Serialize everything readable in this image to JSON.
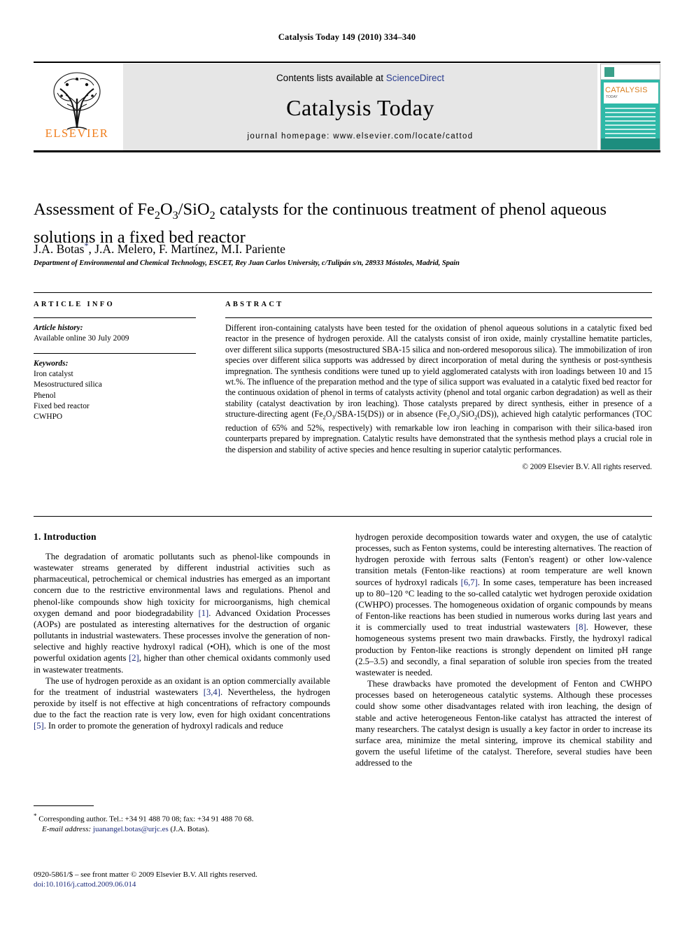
{
  "running_head": "Catalysis Today 149 (2010) 334–340",
  "masthead": {
    "contents_prefix": "Contents lists available at ",
    "sciencedirect": "ScienceDirect",
    "journal_name": "Catalysis Today",
    "homepage": "journal homepage: www.elsevier.com/locate/cattod",
    "publisher": "ELSEVIER",
    "cover": {
      "title": "CATALYSIS",
      "subtitle": "TODAY"
    }
  },
  "article": {
    "title_line1_a": "Assessment of Fe",
    "title_sub1": "2",
    "title_line1_b": "O",
    "title_sub2": "3",
    "title_line1_c": "/SiO",
    "title_sub3": "2",
    "title_line1_d": " catalysts for the continuous treatment of phenol",
    "title_line2": "aqueous solutions in a fixed bed reactor",
    "authors": "J.A. Botas",
    "author_mark": "*",
    "authors_rest": ", J.A. Melero, F. Martínez, M.I. Pariente",
    "affiliation": "Department of Environmental and Chemical Technology, ESCET, Rey Juan Carlos University, c/Tulipán s/n, 28933 Móstoles, Madrid, Spain"
  },
  "info": {
    "heading": "ARTICLE INFO",
    "history_label": "Article history:",
    "history_value": "Available online 30 July 2009",
    "keywords_label": "Keywords:",
    "keywords": [
      "Iron catalyst",
      "Mesostructured silica",
      "Phenol",
      "Fixed bed reactor",
      "CWHPO"
    ]
  },
  "abstract": {
    "heading": "ABSTRACT",
    "p1_a": "Different iron-containing catalysts have been tested for the oxidation of phenol aqueous solutions in a catalytic fixed bed reactor in the presence of hydrogen peroxide. All the catalysts consist of iron oxide, mainly crystalline hematite particles, over different silica supports (mesostructured SBA-15 silica and non-ordered mesoporous silica). The immobilization of iron species over different silica supports was addressed by direct incorporation of metal during the synthesis or post-synthesis impregnation. The synthesis conditions were tuned up to yield agglomerated catalysts with iron loadings between 10 and 15 wt.%. The influence of the preparation method and the type of silica support was evaluated in a catalytic fixed bed reactor for the continuous oxidation of phenol in terms of catalysts activity (phenol and total organic carbon degradation) as well as their stability (catalyst deactivation by iron leaching). Those catalysts prepared by direct synthesis, either in presence of a structure-directing agent (Fe",
    "sub_a": "2",
    "p1_b": "O",
    "sub_b": "3",
    "p1_c": "/SBA-15(DS)) or in absence (Fe",
    "sub_c": "2",
    "p1_d": "O",
    "sub_d": "3",
    "p1_e": "/SiO",
    "sub_e": "2",
    "p1_f": "(DS)), achieved high catalytic performances (TOC reduction of 65% and 52%, respectively) with remarkable low iron leaching in comparison with their silica-based iron counterparts prepared by impregnation. Catalytic results have demonstrated that the synthesis method plays a crucial role in the dispersion and stability of active species and hence resulting in superior catalytic performances.",
    "copyright": "© 2009 Elsevier B.V. All rights reserved."
  },
  "body": {
    "section_number_title": "1. Introduction",
    "left_p1_a": "The degradation of aromatic pollutants such as phenol-like compounds in wastewater streams generated by different industrial activities such as pharmaceutical, petrochemical or chemical industries has emerged as an important concern due to the restrictive environmental laws and regulations. Phenol and phenol-like compounds show high toxicity for microorganisms, high chemical oxygen demand and poor biodegradability ",
    "ref1": "[1]",
    "left_p1_b": ". Advanced Oxidation Processes (AOPs) are postulated as interesting alternatives for the destruction of organic pollutants in industrial wastewaters. These processes involve the generation of non-selective and highly reactive hydroxyl radical (•OH), which is one of the most powerful oxidation agents ",
    "ref2": "[2]",
    "left_p1_c": ", higher than other chemical oxidants commonly used in wastewater treatments.",
    "left_p2_a": "The use of hydrogen peroxide as an oxidant is an option commercially available for the treatment of industrial wastewaters ",
    "ref34": "[3,4]",
    "left_p2_b": ". Nevertheless, the hydrogen peroxide by itself is not effective at high concentrations of refractory compounds due to the fact the reaction rate is very low, even for high oxidant concentrations ",
    "ref5": "[5]",
    "left_p2_c": ". In order to promote the generation of hydroxyl radicals and reduce",
    "right_p1_a": "hydrogen peroxide decomposition towards water and oxygen, the use of catalytic processes, such as Fenton systems, could be interesting alternatives. The reaction of hydrogen peroxide with ferrous salts (Fenton's reagent) or other low-valence transition metals (Fenton-like reactions) at room temperature are well known sources of hydroxyl radicals ",
    "ref67": "[6,7]",
    "right_p1_b": ". In some cases, temperature has been increased up to 80–120 °C leading to the so-called catalytic wet hydrogen peroxide oxidation (CWHPO) processes. The homogeneous oxidation of organic compounds by means of Fenton-like reactions has been studied in numerous works during last years and it is commercially used to treat industrial wastewaters ",
    "ref8": "[8]",
    "right_p1_c": ". However, these homogeneous systems present two main drawbacks. Firstly, the hydroxyl radical production by Fenton-like reactions is strongly dependent on limited pH range (2.5–3.5) and secondly, a final separation of soluble iron species from the treated wastewater is needed.",
    "right_p2": "These drawbacks have promoted the development of Fenton and CWHPO processes based on heterogeneous catalytic systems. Although these processes could show some other disadvantages related with iron leaching, the design of stable and active heterogeneous Fenton-like catalyst has attracted the interest of many researchers. The catalyst design is usually a key factor in order to increase its surface area, minimize the metal sintering, improve its chemical stability and govern the useful lifetime of the catalyst. Therefore, several studies have been addressed to the"
  },
  "footnote": {
    "star": "*",
    "corresponding": " Corresponding author. Tel.: +34 91 488 70 08; fax: +34 91 488 70 68.",
    "email_label": "E-mail address:",
    "email": "juanangel.botas@urjc.es",
    "email_owner": "(J.A. Botas)."
  },
  "footer": {
    "issn_line": "0920-5861/$ – see front matter © 2009 Elsevier B.V. All rights reserved.",
    "doi_prefix": "doi:",
    "doi": "10.1016/j.cattod.2009.06.014"
  },
  "colors": {
    "link": "#1b2a7a",
    "sciencedirect": "#2b3d8f",
    "elsevier_orange": "#f07d1b",
    "cover_teal": "#2fb9a8",
    "panel_gray": "#e6e6e6"
  }
}
